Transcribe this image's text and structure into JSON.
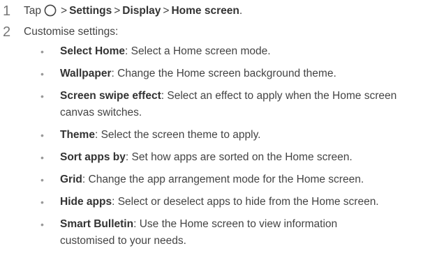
{
  "steps": [
    {
      "number": "1",
      "prefix": "Tap",
      "path": [
        "Settings",
        "Display",
        "Home screen"
      ],
      "separator": ">",
      "suffix": "."
    },
    {
      "number": "2",
      "text": "Customise settings:"
    }
  ],
  "icon": "home-circle-icon",
  "items": [
    {
      "title": "Select Home",
      "desc": "Select a Home screen mode."
    },
    {
      "title": "Wallpaper",
      "desc": "Change the Home screen background theme."
    },
    {
      "title": "Screen swipe effect",
      "desc": "Select an effect to apply when the Home screen canvas switches."
    },
    {
      "title": "Theme",
      "desc": "Select the screen theme to apply."
    },
    {
      "title": "Sort apps by",
      "desc": "Set how apps are sorted on the Home screen."
    },
    {
      "title": "Grid",
      "desc": "Change the app arrangement mode for the Home screen."
    },
    {
      "title": "Hide apps",
      "desc": "Select or deselect apps to hide from the Home screen."
    },
    {
      "title": "Smart Bulletin",
      "desc": "Use the Home screen to view information customised to your needs."
    }
  ],
  "colon": ":",
  "bullet_char": "•"
}
